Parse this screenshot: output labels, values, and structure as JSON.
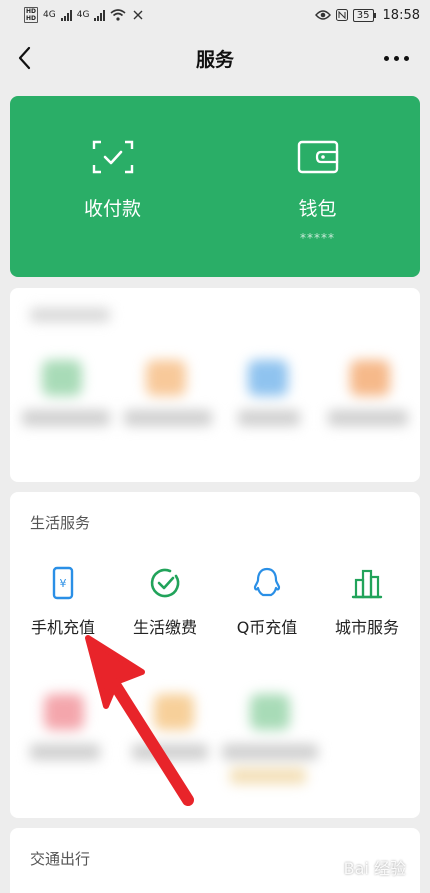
{
  "status_bar": {
    "net1": "4G",
    "net2": "4G",
    "battery": "35",
    "time": "18:58"
  },
  "nav": {
    "title": "服务"
  },
  "wallet_card": {
    "color": "#2aae67",
    "items": [
      {
        "label": "收付款",
        "icon": "scan-pay-icon"
      },
      {
        "label": "钱包",
        "sublabel": "*****",
        "icon": "wallet-icon"
      }
    ]
  },
  "life_services": {
    "title": "生活服务",
    "items": [
      {
        "label": "手机充值",
        "icon": "phone-recharge-icon"
      },
      {
        "label": "生活缴费",
        "icon": "utility-pay-icon"
      },
      {
        "label": "Q币充值",
        "icon": "qq-coin-icon"
      },
      {
        "label": "城市服务",
        "icon": "city-service-icon"
      }
    ]
  },
  "traffic": {
    "title": "交通出行"
  },
  "watermark": "Bai 经验"
}
